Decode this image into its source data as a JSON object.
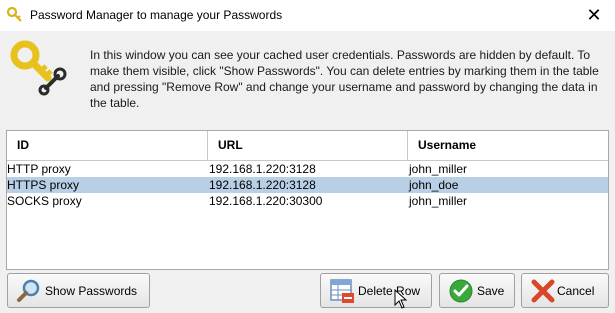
{
  "window": {
    "title": "Password Manager to manage your Passwords",
    "close_glyph": "✕"
  },
  "description": "In this window you can see your cached user credentials. Passwords are hidden by default. To make them visible, click \"Show Passwords\". You can delete entries by marking them in the table and pressing \"Remove Row\" and change your username and password by changing the data in the table.",
  "table": {
    "columns": [
      "ID",
      "URL",
      "Username"
    ],
    "rows": [
      {
        "id": "HTTP proxy",
        "url": "192.168.1.220:3128",
        "username": "john_miller",
        "selected": false
      },
      {
        "id": "HTTPS proxy",
        "url": "192.168.1.220:3128",
        "username": "john_doe",
        "selected": true
      },
      {
        "id": "SOCKS proxy",
        "url": "192.168.1.220:30300",
        "username": "john_miller",
        "selected": false
      }
    ]
  },
  "buttons": {
    "show_passwords": "Show Passwords",
    "delete_row": "Delete Row",
    "save": "Save",
    "cancel": "Cancel"
  },
  "icons": {
    "app": "key-icon",
    "header": "key-wrench-icon",
    "show_passwords": "magnifier-icon",
    "delete_row": "table-delete-icon",
    "save": "checkmark-icon",
    "cancel": "cross-icon"
  },
  "colors": {
    "selection": "#b8cfe5",
    "key": "#e8c21c",
    "save_green": "#3aa83a",
    "cancel_red": "#d9472b"
  }
}
